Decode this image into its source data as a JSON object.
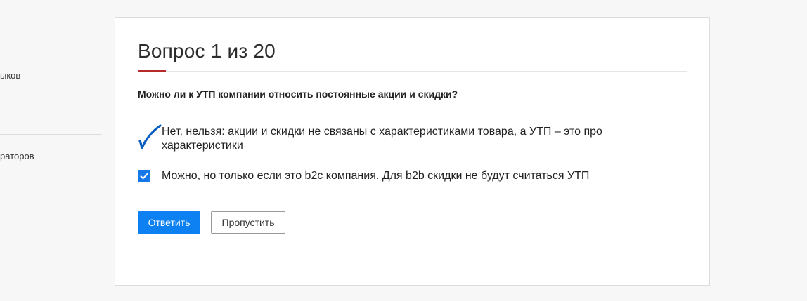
{
  "sidebar": {
    "items": [
      {
        "label": "ыков"
      },
      {
        "label": "раторов"
      }
    ]
  },
  "quiz": {
    "title": "Вопрос 1 из 20",
    "question": "Можно ли к УТП компании относить постоянные акции и скидки?",
    "options": [
      {
        "text": "Нет, нельзя: акции и скидки не связаны с характеристиками товара, а УТП – это про характеристики",
        "marker": "handwritten-check-icon",
        "selected": true
      },
      {
        "text": "Можно, но только если это b2c компания. Для b2b скидки не будут считаться УТП",
        "marker": "checkbox-checked",
        "selected": true
      }
    ],
    "submit_label": "Ответить",
    "skip_label": "Пропустить"
  },
  "colors": {
    "accent": "#0d80f2",
    "title_underline": "#b52b2b",
    "checkbox": "#1677e6"
  }
}
